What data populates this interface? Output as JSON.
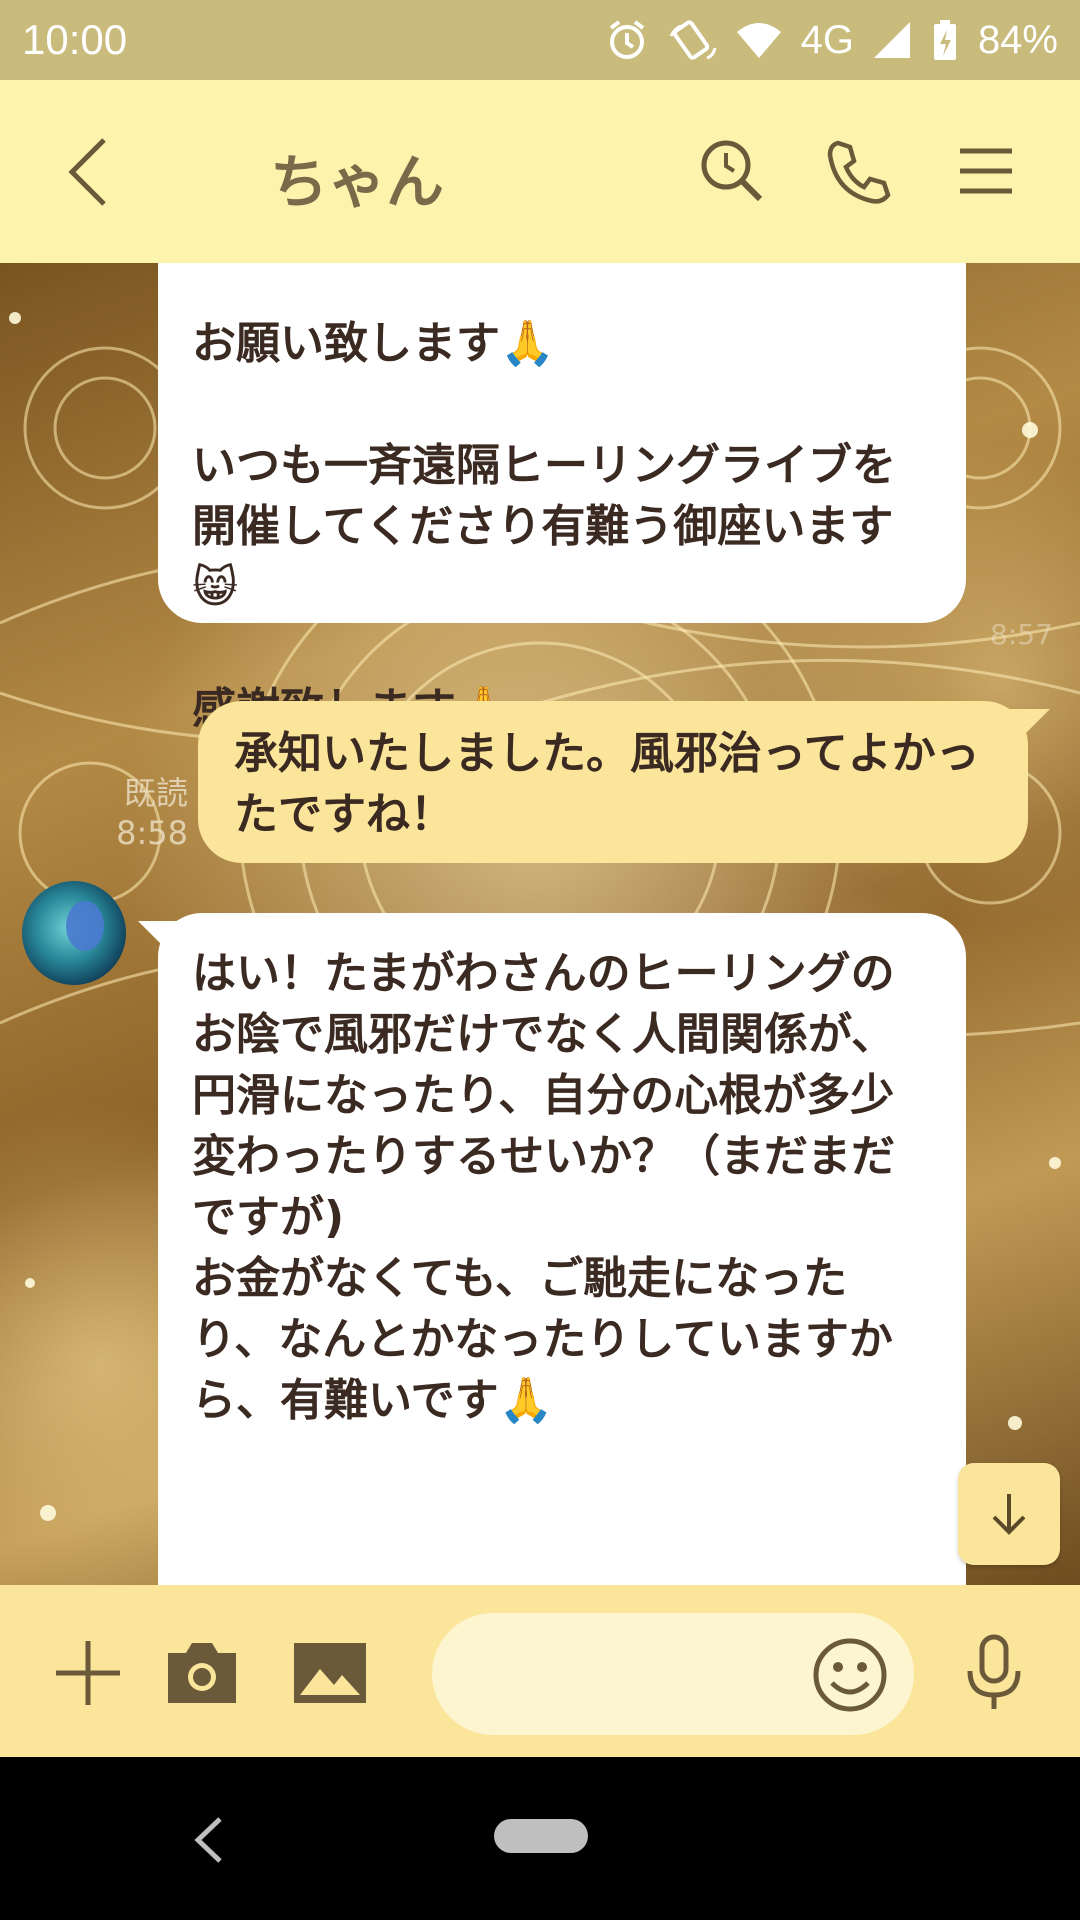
{
  "status_bar": {
    "time": "10:00",
    "network": "4G",
    "battery": "84%"
  },
  "header": {
    "title": "ちゃん"
  },
  "messages": {
    "in1_text": "お願い致します🙏\n\nいつも一斉遠隔ヒーリングライブを開催してくださり有難う御座います😸\n\n感謝致します🙏",
    "in1_time": "8:57",
    "out1_text": "承知いたしました。風邪治ってよかったですね！",
    "out1_read": "既読",
    "out1_time": "8:58",
    "in2_text": "はい！たまがわさんのヒーリングのお陰で風邪だけでなく人間関係が、円滑になったり、自分の心根が多少変わったりするせいか？（まだまだですが)\nお金がなくても、ご馳走になったり、なんとかなったりしていますから、有難いです🙏"
  },
  "input": {
    "placeholder": ""
  },
  "colors": {
    "header_bg": "#fcf3ad",
    "status_bg": "#c8bb7c",
    "my_bubble": "#fbe59a",
    "input_bar": "#fbe59a"
  }
}
